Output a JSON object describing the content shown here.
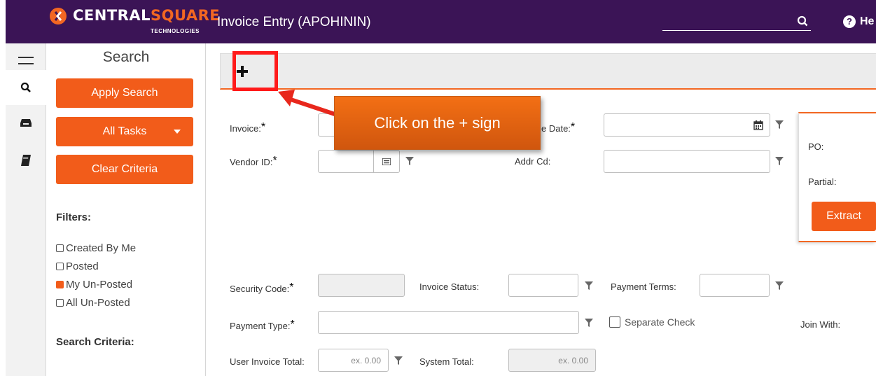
{
  "header": {
    "logo_text_a": "CENTRAL",
    "logo_text_b": "SQUARE",
    "logo_sub": "TECHNOLOGIES",
    "title": "Invoice Entry (APOHININ)",
    "help_label": "He",
    "search_icon": "search-icon",
    "help_icon": "question-circle-icon"
  },
  "rail": {
    "items": [
      {
        "icon": "hamburger-menu-icon"
      },
      {
        "icon": "search-icon"
      },
      {
        "icon": "inbox-icon"
      },
      {
        "icon": "book-icon"
      }
    ]
  },
  "sidebar": {
    "title": "Search",
    "apply_label": "Apply Search",
    "tasks_label": "All Tasks",
    "clear_label": "Clear Criteria",
    "filters_heading": "Filters:",
    "filters": [
      {
        "label": "Created By Me",
        "checked": false
      },
      {
        "label": "Posted",
        "checked": false
      },
      {
        "label": "My Un-Posted",
        "checked": true
      },
      {
        "label": "All Un-Posted",
        "checked": false
      }
    ],
    "criteria_heading": "Search Criteria:"
  },
  "form": {
    "add_icon": "plus-icon",
    "invoice_label": "Invoice:",
    "invoice_date_label": "e Date:",
    "vendor_label": "Vendor ID:",
    "addr_label": "Addr Cd:",
    "po_label": "PO:",
    "partial_label": "Partial:",
    "extract_label": "Extract",
    "security_label": "Security Code:",
    "status_label": "Invoice Status:",
    "terms_label": "Payment Terms:",
    "paytype_label": "Payment Type:",
    "separate_label": "Separate Check",
    "join_label": "Join With:",
    "user_total_label": "User Invoice Total:",
    "user_total_placeholder": "ex. 0.00",
    "system_total_label": "System Total:",
    "system_total_placeholder": "ex. 0.00",
    "required_mark": "*"
  },
  "callout": {
    "text": "Click on the + sign"
  },
  "colors": {
    "header_bg": "#3b1456",
    "accent": "#f25c1a",
    "highlight": "#ff1a1a"
  }
}
